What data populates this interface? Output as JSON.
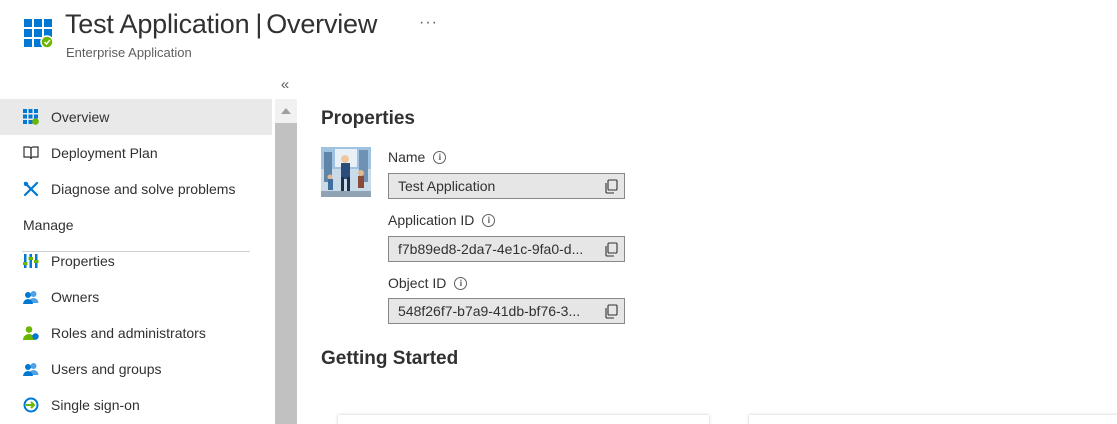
{
  "header": {
    "app_name": "Test Application",
    "separator": "|",
    "section": "Overview",
    "subtitle": "Enterprise Application",
    "more_label": "···"
  },
  "sidebar": {
    "collapse_label": "«",
    "items": [
      {
        "label": "Overview",
        "icon": "grid-app-icon",
        "active": true
      },
      {
        "label": "Deployment Plan",
        "icon": "book-icon"
      },
      {
        "label": "Diagnose and solve problems",
        "icon": "wrench-icon"
      }
    ],
    "manage_header": "Manage",
    "manage_items": [
      {
        "label": "Properties",
        "icon": "properties-icon"
      },
      {
        "label": "Owners",
        "icon": "owners-icon"
      },
      {
        "label": "Roles and administrators",
        "icon": "roles-icon"
      },
      {
        "label": "Users and groups",
        "icon": "users-groups-icon"
      },
      {
        "label": "Single sign-on",
        "icon": "sso-icon"
      }
    ]
  },
  "main": {
    "properties_heading": "Properties",
    "fields": [
      {
        "label": "Name",
        "value": "Test Application"
      },
      {
        "label": "Application ID",
        "value": "f7b89ed8-2da7-4e1c-9fa0-d..."
      },
      {
        "label": "Object ID",
        "value": "548f26f7-b7a9-41db-bf76-3..."
      }
    ],
    "getting_started_heading": "Getting Started"
  },
  "colors": {
    "azure_blue": "#0078d4",
    "azure_green": "#6bb700",
    "nav_active_bg": "#e9e9e9",
    "field_bg": "#e6e6e6"
  }
}
